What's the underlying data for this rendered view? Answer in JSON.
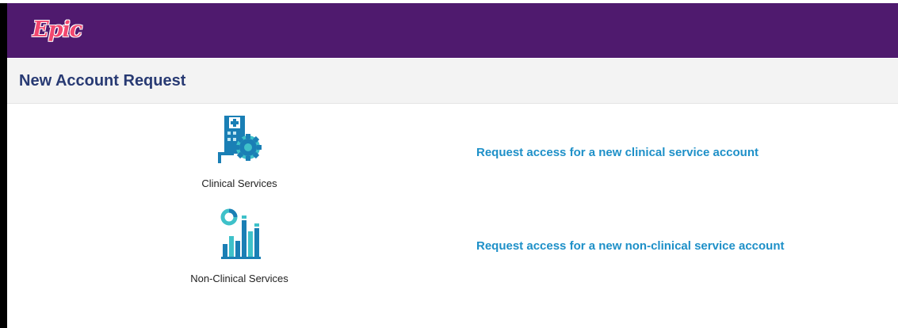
{
  "app": {
    "logo_text": "Epic"
  },
  "page": {
    "title": "New Account Request"
  },
  "options": [
    {
      "label": "Clinical Services",
      "link_text": "Request access for a new clinical service account",
      "icon": "hospital-gear-icon"
    },
    {
      "label": "Non-Clinical Services",
      "link_text": "Request access for a new non-clinical service account",
      "icon": "bar-chart-icon"
    }
  ],
  "colors": {
    "header_bg": "#4f1a6e",
    "title": "#283a73",
    "link": "#1e90c8",
    "icon_blue": "#1a7fb5",
    "icon_teal": "#3ec1c9"
  }
}
